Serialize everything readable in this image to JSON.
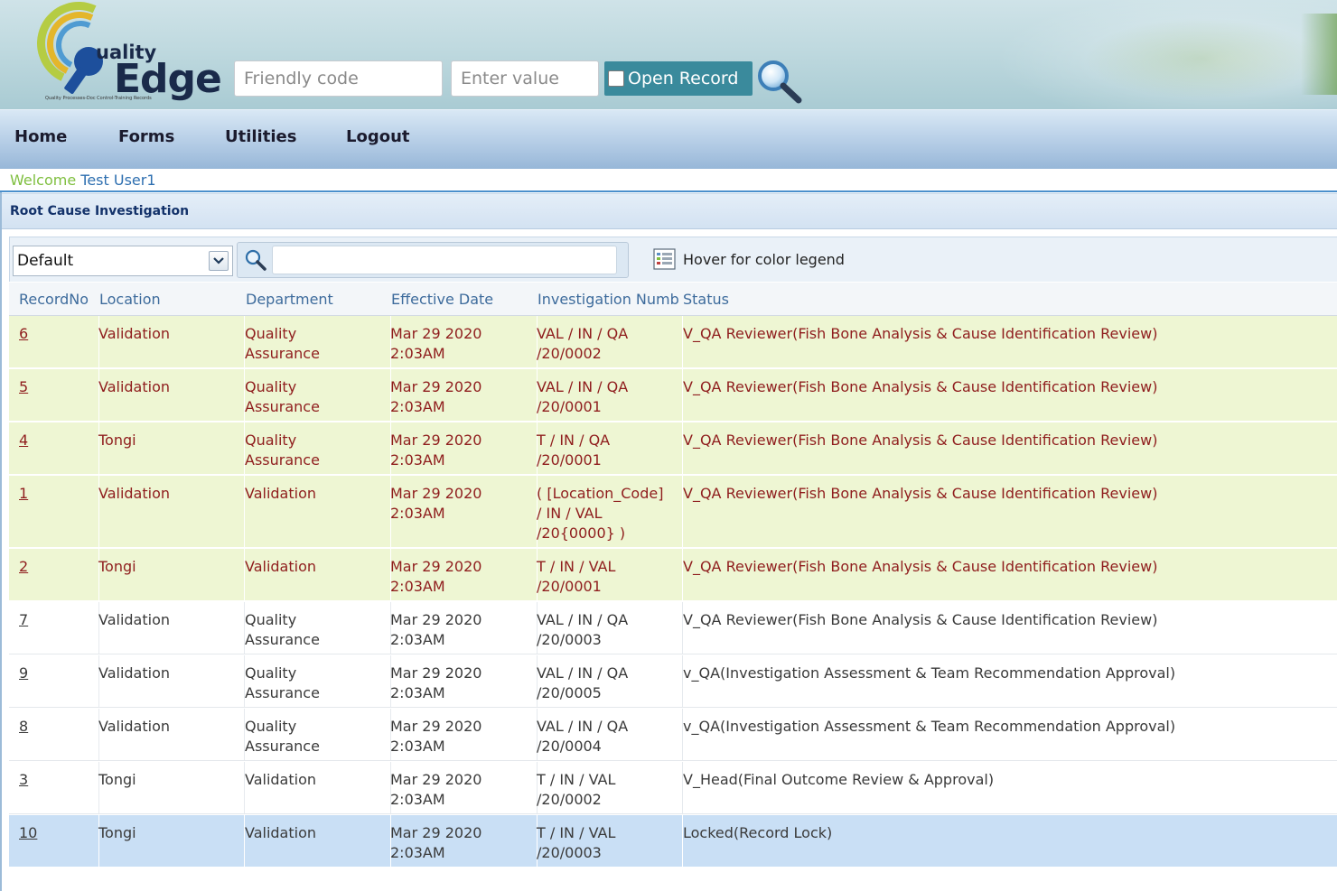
{
  "header": {
    "logo": {
      "word1": "uality",
      "word2": "Edge",
      "tagline": "Quality Processes-Doc Control-Training Records"
    },
    "friendly_placeholder": "Friendly code",
    "value_placeholder": "Enter value",
    "open_record_label": "Open Record",
    "colors": {
      "open_record_bg": "#3a8a9c",
      "logo_dark": "#1a2a4a"
    }
  },
  "nav": {
    "items": [
      "Home",
      "Forms",
      "Utilities",
      "Logout"
    ]
  },
  "welcome": {
    "prefix": "Welcome",
    "user": "Test User1"
  },
  "panel": {
    "title": "Root Cause Investigation"
  },
  "toolbar": {
    "view_selected": "Default",
    "search_value": "",
    "legend_label": "Hover for color legend"
  },
  "table": {
    "columns": [
      "RecordNo",
      "Location",
      "Department",
      "Effective Date",
      "Investigation Numb",
      "Status"
    ],
    "rows": [
      {
        "style": "green",
        "record": "6",
        "location": "Validation",
        "department": [
          "Quality",
          "Assurance"
        ],
        "date": [
          "Mar 29 2020",
          "2:03AM"
        ],
        "inv": [
          "VAL / IN / QA",
          "/20/0002"
        ],
        "status": "V_QA Reviewer(Fish Bone Analysis & Cause Identification Review)"
      },
      {
        "style": "green",
        "record": "5",
        "location": "Validation",
        "department": [
          "Quality",
          "Assurance"
        ],
        "date": [
          "Mar 29 2020",
          "2:03AM"
        ],
        "inv": [
          "VAL / IN / QA",
          "/20/0001"
        ],
        "status": "V_QA Reviewer(Fish Bone Analysis & Cause Identification Review)"
      },
      {
        "style": "green",
        "record": "4",
        "location": "Tongi",
        "department": [
          "Quality",
          "Assurance"
        ],
        "date": [
          "Mar 29 2020",
          "2:03AM"
        ],
        "inv": [
          "T / IN / QA",
          "/20/0001"
        ],
        "status": "V_QA Reviewer(Fish Bone Analysis & Cause Identification Review)"
      },
      {
        "style": "green",
        "record": "1",
        "location": "Validation",
        "department": [
          "Validation"
        ],
        "date": [
          "Mar 29 2020",
          "2:03AM"
        ],
        "inv": [
          "( [Location_Code]",
          "/ IN / VAL",
          "/20{0000} )"
        ],
        "status": "V_QA Reviewer(Fish Bone Analysis & Cause Identification Review)"
      },
      {
        "style": "green",
        "record": "2",
        "location": "Tongi",
        "department": [
          "Validation"
        ],
        "date": [
          "Mar 29 2020",
          "2:03AM"
        ],
        "inv": [
          "T / IN / VAL",
          "/20/0001"
        ],
        "status": "V_QA Reviewer(Fish Bone Analysis & Cause Identification Review)"
      },
      {
        "style": "white",
        "record": "7",
        "location": "Validation",
        "department": [
          "Quality",
          "Assurance"
        ],
        "date": [
          "Mar 29 2020",
          "2:03AM"
        ],
        "inv": [
          "VAL / IN / QA",
          "/20/0003"
        ],
        "status": "V_QA Reviewer(Fish Bone Analysis & Cause Identification Review)"
      },
      {
        "style": "white",
        "record": "9",
        "location": "Validation",
        "department": [
          "Quality",
          "Assurance"
        ],
        "date": [
          "Mar 29 2020",
          "2:03AM"
        ],
        "inv": [
          "VAL / IN / QA",
          "/20/0005"
        ],
        "status": "v_QA(Investigation Assessment & Team Recommendation Approval)"
      },
      {
        "style": "white",
        "record": "8",
        "location": "Validation",
        "department": [
          "Quality",
          "Assurance"
        ],
        "date": [
          "Mar 29 2020",
          "2:03AM"
        ],
        "inv": [
          "VAL / IN / QA",
          "/20/0004"
        ],
        "status": "v_QA(Investigation Assessment & Team Recommendation Approval)"
      },
      {
        "style": "white",
        "record": "3",
        "location": "Tongi",
        "department": [
          "Validation"
        ],
        "date": [
          "Mar 29 2020",
          "2:03AM"
        ],
        "inv": [
          "T / IN / VAL",
          "/20/0002"
        ],
        "status": "V_Head(Final Outcome Review & Approval)"
      },
      {
        "style": "selected",
        "record": "10",
        "location": "Tongi",
        "department": [
          "Validation"
        ],
        "date": [
          "Mar 29 2020",
          "2:03AM"
        ],
        "inv": [
          "T / IN / VAL",
          "/20/0003"
        ],
        "status": "Locked(Record Lock)"
      }
    ]
  },
  "icons": {
    "search_big": "magnifier-icon",
    "filter": "magnifier-icon",
    "legend": "legend-grid-icon",
    "dropdown": "chevron-down-icon"
  },
  "row_colors": {
    "green": "#eef6d3",
    "white": "#ffffff",
    "selected": "#c9dff5"
  }
}
